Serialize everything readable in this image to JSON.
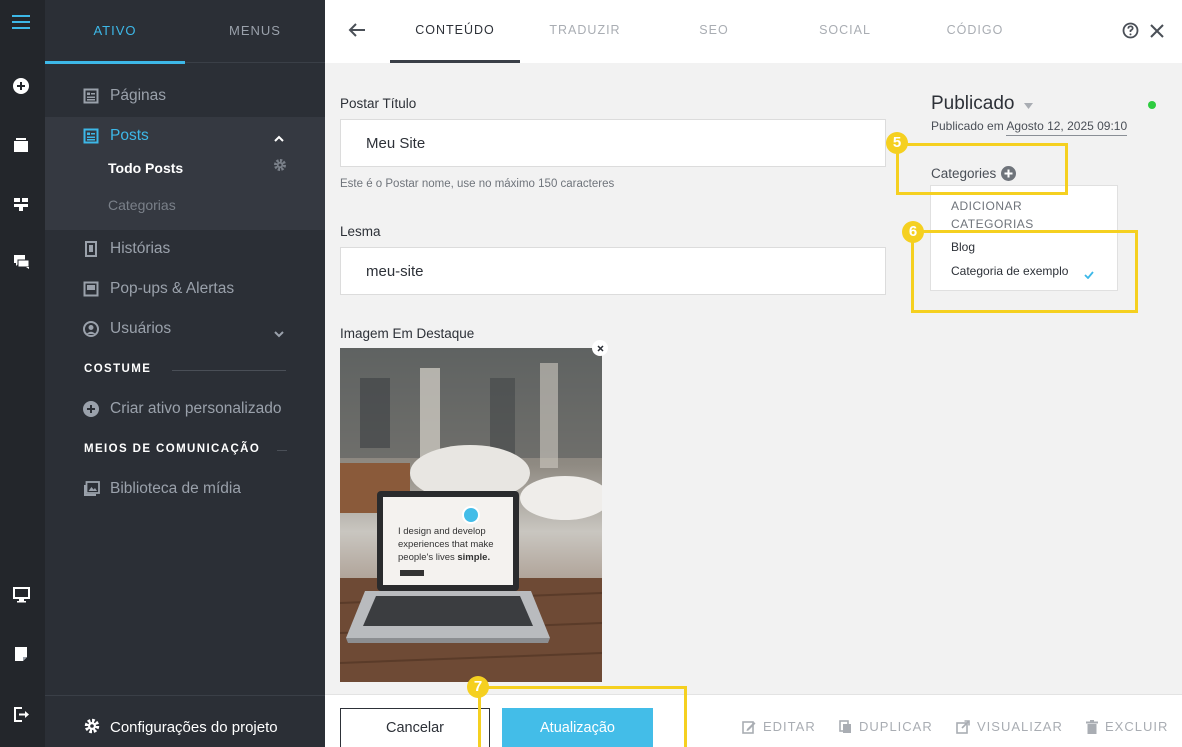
{
  "sidebar": {
    "tabs": [
      "ATIVO",
      "MENUS"
    ],
    "items": {
      "paginas": "Páginas",
      "posts": "Posts",
      "todo_posts": "Todo Posts",
      "categorias": "Categorias",
      "historias": "Histórias",
      "popups": "Pop-ups & Alertas",
      "usuarios": "Usuários"
    },
    "section_costume": "COSTUME",
    "criar_ativo": "Criar ativo personalizado",
    "section_meios": "MEIOS DE COMUNICAÇÃO",
    "biblioteca": "Biblioteca de mídia",
    "footer": "Configurações do projeto"
  },
  "topbar": {
    "tabs": [
      "CONTEÚDO",
      "TRADUZIR",
      "SEO",
      "SOCIAL",
      "CÓDIGO"
    ]
  },
  "form": {
    "title_label": "Postar Título",
    "title_value": "Meu Site",
    "title_hint": "Este é o Postar nome, use no máximo 150 caracteres",
    "slug_label": "Lesma",
    "slug_value": "meu-site",
    "image_label": "Imagem Em Destaque",
    "image_screen_text": "I design and develop experiences that make people's lives simple."
  },
  "publish": {
    "status": "Publicado",
    "published_on_label": "Publicado em",
    "date": "Agosto 12, 2025 09:10",
    "status_color": "#2ecc40"
  },
  "categories": {
    "label": "Categories",
    "add": "ADICIONAR CATEGORIAS",
    "options": [
      "Blog",
      "Categoria de exemplo"
    ],
    "checked": "Categoria de exemplo"
  },
  "annotations": [
    "5",
    "6",
    "7"
  ],
  "bottom": {
    "cancel": "Cancelar",
    "update": "Atualização",
    "edit": "EDITAR",
    "duplicate": "DUPLICAR",
    "preview": "VISUALIZAR",
    "delete": "EXCLUIR"
  },
  "colors": {
    "accent": "#3db8e8",
    "highlight": "#f5d020"
  }
}
